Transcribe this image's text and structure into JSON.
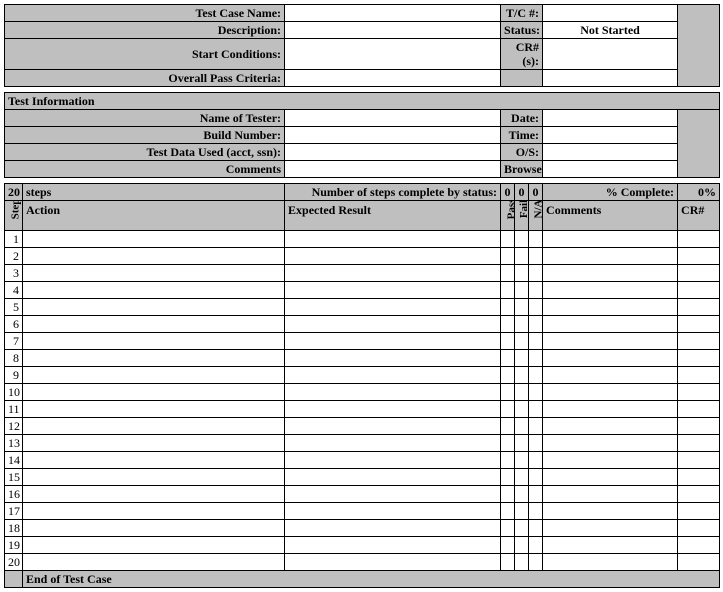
{
  "header": {
    "labels": {
      "test_case_name": "Test Case Name:",
      "description": "Description:",
      "start_conditions": "Start Conditions:",
      "overall_pass_criteria": "Overall Pass Criteria:",
      "tc_num": "T/C #:",
      "status": "Status:",
      "cr_nums": "CR#(s):"
    },
    "values": {
      "test_case_name": "",
      "description": "",
      "start_conditions": "",
      "overall_pass_criteria": "",
      "tc_num": "",
      "status": "Not Started",
      "cr_nums": ""
    }
  },
  "test_info": {
    "title": "Test Information",
    "labels": {
      "name_of_tester": "Name of Tester:",
      "build_number": "Build Number:",
      "test_data_used": "Test Data Used (acct, ssn):",
      "comments": "Comments",
      "date": "Date:",
      "time": "Time:",
      "os": "O/S:",
      "browser": "Browser:"
    },
    "values": {
      "name_of_tester": "",
      "build_number": "",
      "test_data_used": "",
      "comments": "",
      "date": "",
      "time": "",
      "os": "",
      "browser": ""
    }
  },
  "steps_summary": {
    "count": "20",
    "count_label": "steps",
    "complete_label": "Number of steps complete by status:",
    "pass_count": "0",
    "fail_count": "0",
    "na_count": "0",
    "pct_label": "% Complete:",
    "pct_value": "0%"
  },
  "columns": {
    "step": "Step",
    "action": "Action",
    "expected": "Expected Result",
    "pass": "Pass",
    "fail": "Fail",
    "na": "N/A",
    "comments": "Comments",
    "cr": "CR#"
  },
  "rows": [
    {
      "n": "1"
    },
    {
      "n": "2"
    },
    {
      "n": "3"
    },
    {
      "n": "4"
    },
    {
      "n": "5"
    },
    {
      "n": "6"
    },
    {
      "n": "7"
    },
    {
      "n": "8"
    },
    {
      "n": "9"
    },
    {
      "n": "10"
    },
    {
      "n": "11"
    },
    {
      "n": "12"
    },
    {
      "n": "13"
    },
    {
      "n": "14"
    },
    {
      "n": "15"
    },
    {
      "n": "16"
    },
    {
      "n": "17"
    },
    {
      "n": "18"
    },
    {
      "n": "19"
    },
    {
      "n": "20"
    }
  ],
  "footer": {
    "end_label": "End of Test Case"
  }
}
